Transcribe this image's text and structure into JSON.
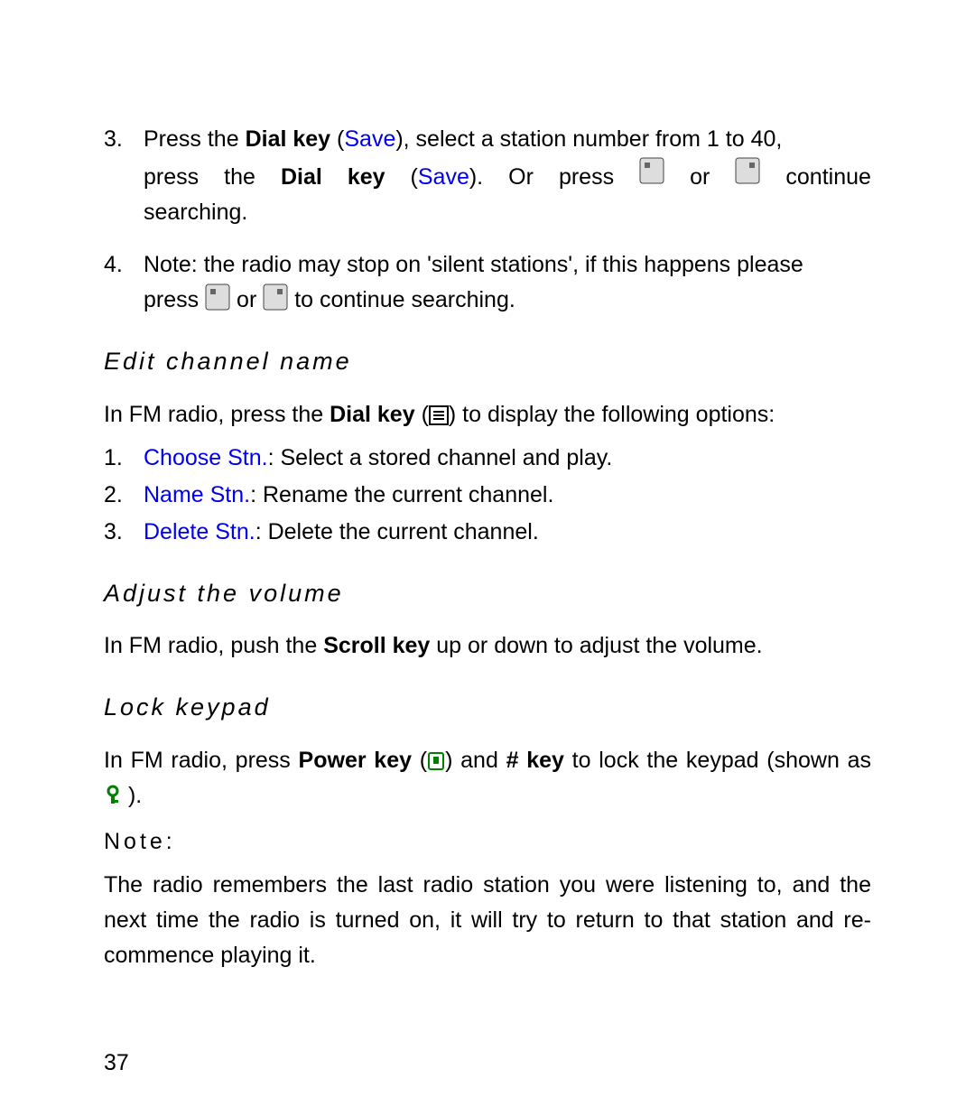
{
  "item3": {
    "num": "3.",
    "l1": {
      "a": "Press the ",
      "b": "Dial key",
      "c": " (",
      "d": "Save",
      "e": "), select a station number from 1 to 40,"
    },
    "l2": {
      "a": "press",
      "b": "the",
      "c": "Dial",
      "d": "key",
      "e": "(",
      "f": "Save",
      "g": ").",
      "h": "Or",
      "i": "press",
      "j": "or",
      "k": "continue"
    },
    "l3": "searching."
  },
  "item4": {
    "num": "4.",
    "l1": "Note: the radio may stop on 'silent stations', if this happens please",
    "l2": {
      "a": "press ",
      "b": " or ",
      "c": " to continue searching."
    }
  },
  "h_edit": "Edit channel name",
  "edit_intro": {
    "a": "In FM radio, press the ",
    "b": "Dial key",
    "c": " (",
    "d": ") to display the following options:"
  },
  "opt1": {
    "num": "1.",
    "a": "Choose Stn.",
    "b": ": Select a stored channel and play."
  },
  "opt2": {
    "num": "2.",
    "a": "Name Stn.",
    "b": ": Rename the current channel."
  },
  "opt3": {
    "num": "3.",
    "a": "Delete Stn.",
    "b": ": Delete the current channel."
  },
  "h_vol": "Adjust the volume",
  "vol_text": {
    "a": "In FM radio, push the ",
    "b": "Scroll key",
    "c": " up or down to adjust the volume."
  },
  "h_lock": "Lock keypad",
  "lock_text": {
    "a": "In FM radio, press ",
    "b": "Power key",
    "c": " (",
    "d": ") and ",
    "e": "# key",
    "f": " to lock the keypad (shown as ",
    "g": " )."
  },
  "note_label": "Note:",
  "note_body": "The radio remembers the last radio station you were listening to, and the next time the radio is turned on, it will try to return to that station and re-commence playing it.",
  "page_number": "37"
}
